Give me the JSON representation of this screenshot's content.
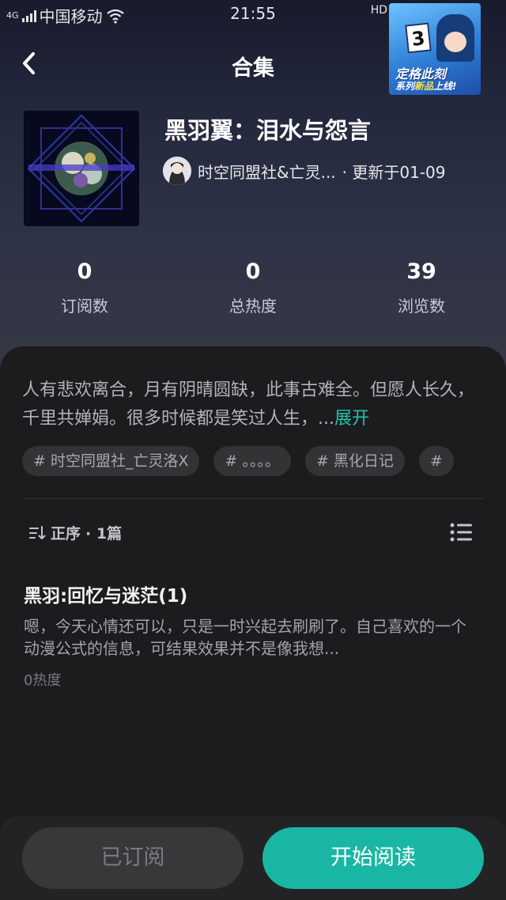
{
  "status_bar": {
    "network_type": "4G",
    "carrier": "中国移动",
    "time": "21:55",
    "hd_label": "HD"
  },
  "nav": {
    "title": "合集",
    "back_icon": "chevron-left-icon"
  },
  "ad_badge": {
    "calendar_number": "3",
    "line1": "定格此刻",
    "line2_prefix": "系列",
    "line2_highlight": "新品",
    "line2_suffix": "上线!"
  },
  "album": {
    "title": "黑羽翼：泪水与怨言",
    "author": "时空同盟社&亡灵...",
    "updated": "· 更新于01-09"
  },
  "stats": [
    {
      "value": "0",
      "label": "订阅数"
    },
    {
      "value": "0",
      "label": "总热度"
    },
    {
      "value": "39",
      "label": "浏览数"
    }
  ],
  "description": {
    "text": "人有悲欢离合，月有阴晴圆缺，此事古难全。但愿人长久，千里共婵娟。很多时候都是笑过人生，...",
    "expand_label": "展开"
  },
  "tags": [
    "# 时空同盟社_亡灵洛X",
    "# 。。。。",
    "# 黑化日记",
    "#"
  ],
  "sort": {
    "order_label": "正序",
    "count_label": "· 1篇"
  },
  "chapters": [
    {
      "title": "黑羽:回忆与迷茫(1)",
      "excerpt": "嗯，今天心情还可以，只是一时兴起去刷刷了。自己喜欢的一个动漫公式的信息，可结果效果并不是像我想...",
      "heat": "0热度"
    }
  ],
  "buttons": {
    "subscribed": "已订阅",
    "start_reading": "开始阅读"
  },
  "colors": {
    "accent": "#19b7a3",
    "expand_link": "#21c2ab",
    "sheet_bg": "#1c1c1f"
  }
}
